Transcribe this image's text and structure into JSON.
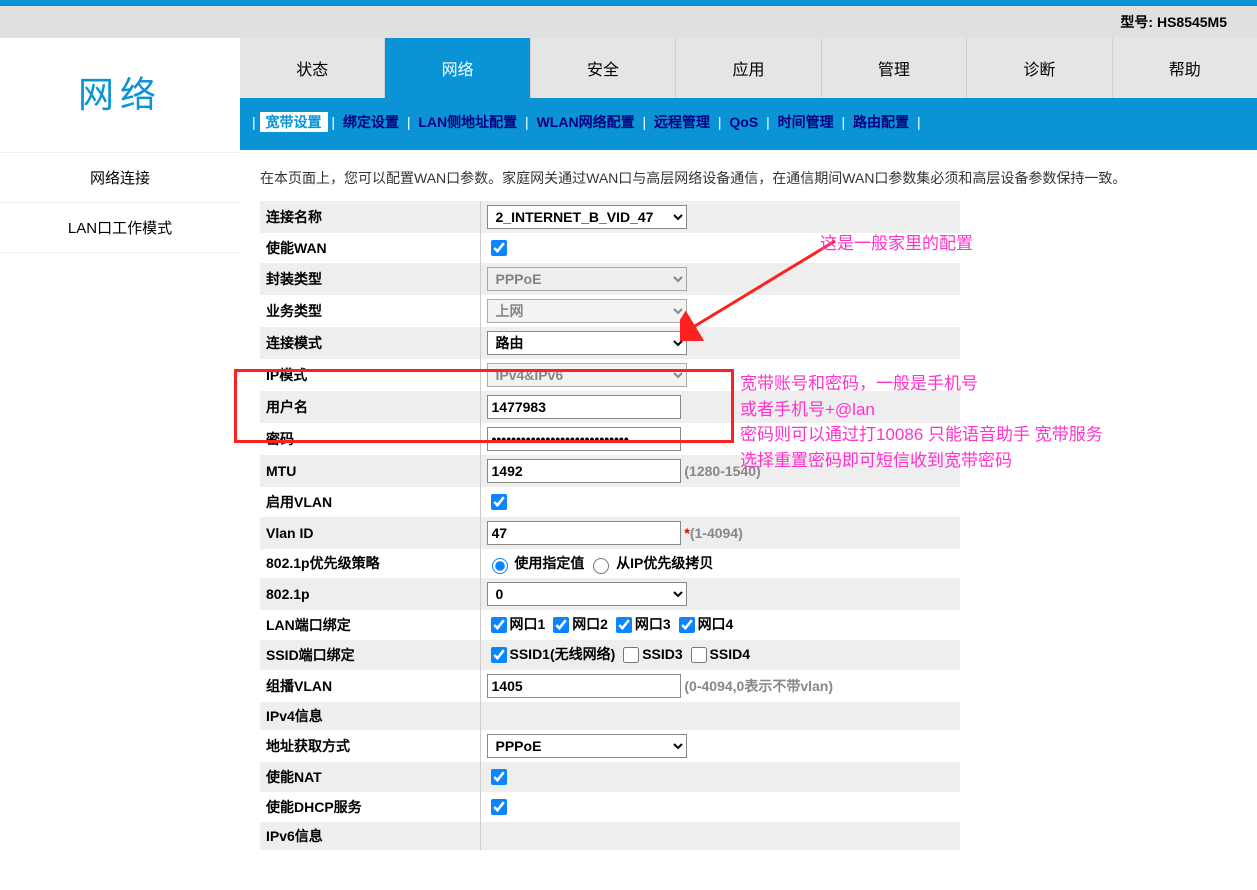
{
  "model_label": "型号: HS8545M5",
  "brand": "网络",
  "sidebar": {
    "items": [
      "网络连接",
      "LAN口工作模式"
    ]
  },
  "tabs": [
    "状态",
    "网络",
    "安全",
    "应用",
    "管理",
    "诊断",
    "帮助"
  ],
  "active_tab_index": 1,
  "subnav": {
    "items": [
      "宽带设置",
      "绑定设置",
      "LAN侧地址配置",
      "WLAN网络配置",
      "远程管理",
      "QoS",
      "时间管理",
      "路由配置"
    ],
    "active_index": 0
  },
  "description": "在本页面上，您可以配置WAN口参数。家庭网关通过WAN口与高层网络设备通信，在通信期间WAN口参数集必须和高层设备参数保持一致。",
  "form": {
    "conn_name_label": "连接名称",
    "conn_name_value": "2_INTERNET_B_VID_47",
    "enable_wan_label": "使能WAN",
    "encap_label": "封装类型",
    "encap_value": "PPPoE",
    "service_label": "业务类型",
    "service_value": "上网",
    "conn_mode_label": "连接模式",
    "conn_mode_value": "路由",
    "ip_mode_label": "IP模式",
    "ip_mode_value": "IPv4&IPv6",
    "user_label": "用户名",
    "user_value": "1477983",
    "pass_label": "密码",
    "pass_value": "••••••••••••••••••••••••••••",
    "mtu_label": "MTU",
    "mtu_value": "1492",
    "mtu_hint": "(1280-1540)",
    "enable_vlan_label": "启用VLAN",
    "vlan_id_label": "Vlan ID",
    "vlan_id_value": "47",
    "vlan_id_hint_star": "*",
    "vlan_id_hint": "(1-4094)",
    "dot1p_policy_label": "802.1p优先级策略",
    "dot1p_opt1": "使用指定值",
    "dot1p_opt2": "从IP优先级拷贝",
    "dot1p_label": "802.1p",
    "dot1p_value": "0",
    "lan_bind_label": "LAN端口绑定",
    "lan_ports": [
      "网口1",
      "网口2",
      "网口3",
      "网口4"
    ],
    "ssid_bind_label": "SSID端口绑定",
    "ssid_items": [
      "SSID1(无线网络)",
      "SSID3",
      "SSID4"
    ],
    "mcast_vlan_label": "组播VLAN",
    "mcast_vlan_value": "1405",
    "mcast_vlan_hint": "(0-4094,0表示不带vlan)",
    "ipv4_info_label": "IPv4信息",
    "addr_mode_label": "地址获取方式",
    "addr_mode_value": "PPPoE",
    "enable_nat_label": "使能NAT",
    "enable_dhcp_label": "使能DHCP服务",
    "ipv6_info_label": "IPv6信息"
  },
  "annotations": {
    "top": "这是一般家里的配置",
    "block_l1": "宽带账号和密码，一般是手机号",
    "block_l2": "或者手机号+@lan",
    "block_l3": "密码则可以通过打10086 只能语音助手 宽带服务",
    "block_l4": "选择重置密码即可短信收到宽带密码"
  }
}
